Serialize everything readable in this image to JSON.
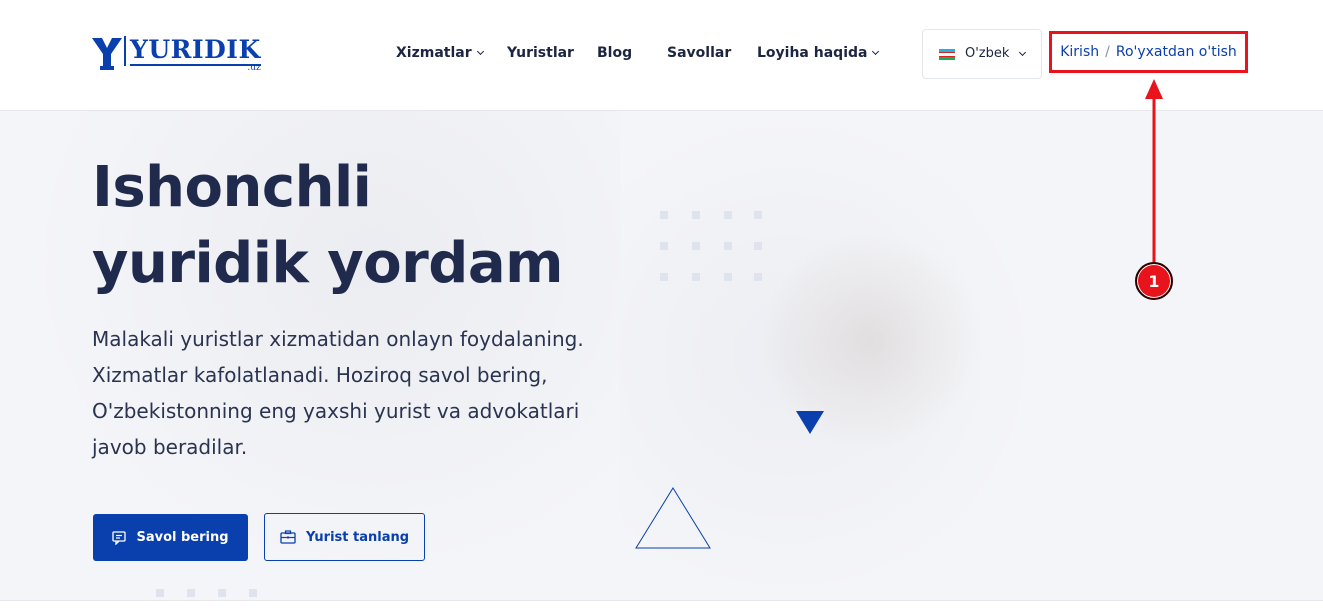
{
  "header": {
    "logo": {
      "word": "YURIDIK",
      "suffix": ".uz"
    },
    "nav": [
      {
        "label": "Xizmatlar",
        "dropdown": true
      },
      {
        "label": "Yuristlar",
        "dropdown": false
      },
      {
        "label": "Blog",
        "dropdown": false
      },
      {
        "label": "Savollar",
        "dropdown": false
      },
      {
        "label": "Loyiha haqida",
        "dropdown": true
      }
    ],
    "language": {
      "label": "O'zbek",
      "flag_icon": "uzbekistan-flag-icon"
    },
    "auth": {
      "login_label": "Kirish",
      "separator": "/",
      "register_label": "Ro'yxatdan o'tish"
    }
  },
  "hero": {
    "title_line1": "Ishonchli",
    "title_line2": "yuridik yordam",
    "description": "Malakali yuristlar xizmatidan onlayn foydalaning. Xizmatlar kafolatlanadi. Hoziroq savol bering, O'zbekistonning eng yaxshi yurist va advokatlari javob beradilar.",
    "primary_button": {
      "label": "Savol bering",
      "icon": "chat-question-icon"
    },
    "secondary_button": {
      "label": "Yurist tanlang",
      "icon": "briefcase-icon"
    }
  },
  "annotation": {
    "badge": "1"
  },
  "colors": {
    "brand": "#0a3fae",
    "text_dark": "#1f2a4d",
    "annotation_red": "#e8131b",
    "hero_bg": "#f4f5f8"
  }
}
